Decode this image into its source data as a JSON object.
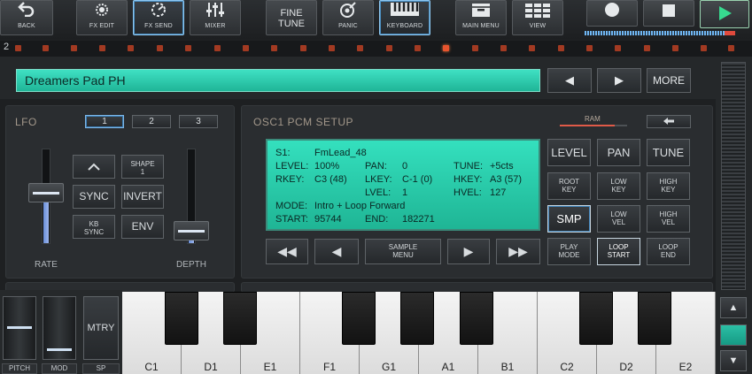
{
  "toolbar": {
    "back": {
      "icon": "back-arrow-icon",
      "label": "BACK"
    },
    "fx_edit": {
      "icon": "fx-edit-icon",
      "label": "FX EDIT"
    },
    "fx_send": {
      "icon": "fx-send-icon",
      "label": "FX SEND"
    },
    "mixer": {
      "icon": "mixer-icon",
      "label": "MIXER"
    },
    "fine_tune": {
      "line1": "FINE",
      "line2": "TUNE"
    },
    "panic": {
      "icon": "panic-icon",
      "label": "PANIC"
    },
    "keyboard": {
      "icon": "keyboard-icon",
      "label": "KEYBOARD"
    },
    "main_menu": {
      "icon": "drawer-icon",
      "label": "MAIN MENU"
    },
    "view": {
      "icon": "grid-view-icon",
      "label": "VIEW"
    },
    "record": {
      "icon": "record-icon"
    },
    "stop": {
      "icon": "stop-icon"
    },
    "play": {
      "icon": "play-icon"
    }
  },
  "part_number": "2",
  "patch": {
    "name": "Dreamers Pad PH",
    "prev_icon": "◀",
    "next_icon": "▶",
    "more_label": "MORE"
  },
  "lfo": {
    "title": "LFO",
    "tabs": [
      "1",
      "2",
      "3"
    ],
    "selected_tab": "1",
    "buttons": {
      "up_icon": "chevron-up-icon",
      "shape_line1": "SHAPE",
      "shape_line2": "1",
      "sync": "SYNC",
      "invert": "INVERT",
      "kb_sync_line1": "KB",
      "kb_sync_line2": "SYNC",
      "env": "ENV"
    },
    "rate_label": "RATE",
    "depth_label": "DEPTH",
    "rate_level": 0.55,
    "depth_level": 0.05
  },
  "osc": {
    "title": "OSC1 PCM SETUP",
    "ram_label": "RAM",
    "back_icon": "arrow-left-icon",
    "lcd": {
      "s1_key": "S1:",
      "s1_val": "FmLead_48",
      "level_key": "LEVEL:",
      "level_val": "100%",
      "pan_key": "PAN:",
      "pan_val": "0",
      "tune_key": "TUNE:",
      "tune_val": "+5cts",
      "rkey_key": "RKEY:",
      "rkey_val": "C3 (48)",
      "lkey_key": "LKEY:",
      "lkey_val": "C-1 (0)",
      "hkey_key": "HKEY:",
      "hkey_val": "A3 (57)",
      "lvel_key": "LVEL:",
      "lvel_val": "1",
      "hvel_key": "HVEL:",
      "hvel_val": "127",
      "mode_key": "MODE:",
      "mode_val": "Intro + Loop Forward",
      "start_key": "START:",
      "start_val": "95744",
      "end_key": "END:",
      "end_val": "182271"
    },
    "transport": {
      "rewind": "◀◀",
      "prev": "◀",
      "sample_menu_line1": "SAMPLE",
      "sample_menu_line2": "MENU",
      "next": "▶",
      "forward": "▶▶"
    },
    "grid": {
      "level": "LEVEL",
      "pan": "PAN",
      "tune": "TUNE",
      "root_key_1": "ROOT",
      "root_key_2": "KEY",
      "low_key_1": "LOW",
      "low_key_2": "KEY",
      "high_key_1": "HIGH",
      "high_key_2": "KEY",
      "smp": "SMP",
      "low_vel_1": "LOW",
      "low_vel_2": "VEL",
      "high_vel_1": "HIGH",
      "high_vel_2": "VEL",
      "play_mode_1": "PLAY",
      "play_mode_2": "MODE",
      "loop_start_1": "LOOP",
      "loop_start_2": "START",
      "loop_end_1": "LOOP",
      "loop_end_2": "END"
    }
  },
  "bottom_left": {
    "mtry": "MTRY",
    "pitch": "PITCH",
    "mod": "MOD",
    "sp": "SP"
  },
  "scroll": {
    "up_icon": "▲",
    "down_icon": "▼"
  },
  "keyboard": {
    "white_keys": [
      "C1",
      "",
      "D1",
      "",
      "E1",
      "",
      "F1",
      "",
      "G1",
      "",
      "A1",
      "",
      "B1",
      "",
      "C2",
      "",
      "D2",
      "",
      "E2",
      ""
    ]
  },
  "colors": {
    "accent_teal": "#2fd3b5",
    "play_green": "#37d98f",
    "led_red": "#e8542e",
    "active_border": "#8ec7f0"
  }
}
